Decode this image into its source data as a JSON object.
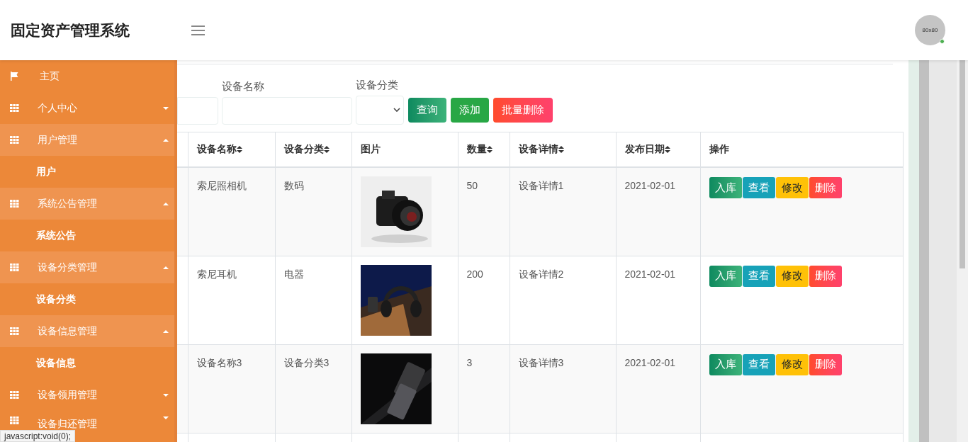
{
  "header": {
    "title": "固定资产管理系统",
    "avatar": "80x80",
    "online": true
  },
  "sidebar": {
    "items": [
      {
        "label": "主页",
        "kind": "link"
      },
      {
        "label": "个人中心",
        "kind": "menu",
        "expanded": false
      },
      {
        "label": "用户管理",
        "kind": "menu",
        "expanded": true,
        "children": [
          {
            "label": "用户"
          }
        ]
      },
      {
        "label": "系统公告管理",
        "kind": "menu",
        "expanded": true,
        "children": [
          {
            "label": "系统公告"
          }
        ]
      },
      {
        "label": "设备分类管理",
        "kind": "menu",
        "expanded": true,
        "children": [
          {
            "label": "设备分类"
          }
        ]
      },
      {
        "label": "设备信息管理",
        "kind": "menu",
        "expanded": true,
        "children": [
          {
            "label": "设备信息"
          }
        ]
      },
      {
        "label": "设备领用管理",
        "kind": "menu",
        "expanded": false
      },
      {
        "label": "设备归还管理",
        "kind": "menu",
        "expanded": false
      }
    ]
  },
  "search": {
    "fields": [
      {
        "kind": "text",
        "label": "设备名称"
      },
      {
        "kind": "select",
        "label": "设备分类"
      }
    ],
    "buttons": [
      {
        "label": "查询",
        "kind": "search"
      },
      {
        "label": "添加",
        "kind": "add"
      },
      {
        "label": "批量删除",
        "kind": "delete"
      }
    ]
  },
  "table": {
    "columns": [
      "设备名称",
      "设备分类",
      "图片",
      "数量",
      "设备详情",
      "发布日期",
      "操作"
    ],
    "rows": [
      {
        "name": "索尼照相机",
        "category": "数码",
        "count": "50",
        "detail": "设备详情1",
        "date": "2021-02-01",
        "actions": [
          {
            "label": "入库",
            "kind": "stock"
          },
          {
            "label": "查看",
            "kind": "view"
          },
          {
            "label": "修改",
            "kind": "edit"
          },
          {
            "label": "删除",
            "kind": "delete"
          }
        ]
      },
      {
        "name": "索尼耳机",
        "category": "电器",
        "count": "200",
        "detail": "设备详情2",
        "date": "2021-02-01",
        "actions": [
          {
            "label": "入库",
            "kind": "stock"
          },
          {
            "label": "查看",
            "kind": "view"
          },
          {
            "label": "修改",
            "kind": "edit"
          },
          {
            "label": "删除",
            "kind": "delete"
          }
        ]
      },
      {
        "name": "设备名称3",
        "category": "设备分类3",
        "count": "3",
        "detail": "设备详情3",
        "date": "2021-02-01",
        "actions": [
          {
            "label": "入库",
            "kind": "stock"
          },
          {
            "label": "查看",
            "kind": "view"
          },
          {
            "label": "修改",
            "kind": "edit"
          },
          {
            "label": "删除",
            "kind": "delete"
          }
        ]
      }
    ]
  },
  "status_bar": {
    "text": "javascript:void(0);"
  }
}
